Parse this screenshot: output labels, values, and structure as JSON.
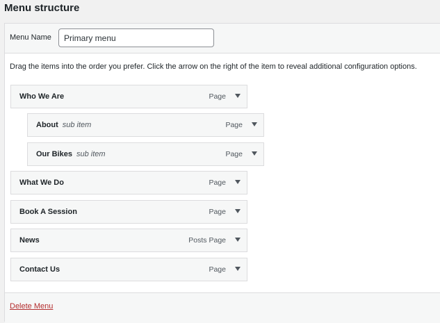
{
  "section_title": "Menu structure",
  "menu_name": {
    "label": "Menu Name",
    "value": "Primary menu"
  },
  "instructions": "Drag the items into the order you prefer. Click the arrow on the right of the item to reveal additional configuration options.",
  "menu_items": [
    {
      "title": "Who We Are",
      "sub": "",
      "type": "Page",
      "depth": 0
    },
    {
      "title": "About",
      "sub": "sub item",
      "type": "Page",
      "depth": 1
    },
    {
      "title": "Our Bikes",
      "sub": "sub item",
      "type": "Page",
      "depth": 1
    },
    {
      "title": "What We Do",
      "sub": "",
      "type": "Page",
      "depth": 0
    },
    {
      "title": "Book A Session",
      "sub": "",
      "type": "Page",
      "depth": 0
    },
    {
      "title": "News",
      "sub": "",
      "type": "Posts Page",
      "depth": 0
    },
    {
      "title": "Contact Us",
      "sub": "",
      "type": "Page",
      "depth": 0
    }
  ],
  "footer": {
    "delete_label": "Delete Menu"
  },
  "icons": {
    "item_toggle": "chevron-down-icon"
  },
  "colors": {
    "delete_link": "#b32d2e",
    "item_background": "#f6f7f7",
    "item_border": "#dcdcde"
  }
}
